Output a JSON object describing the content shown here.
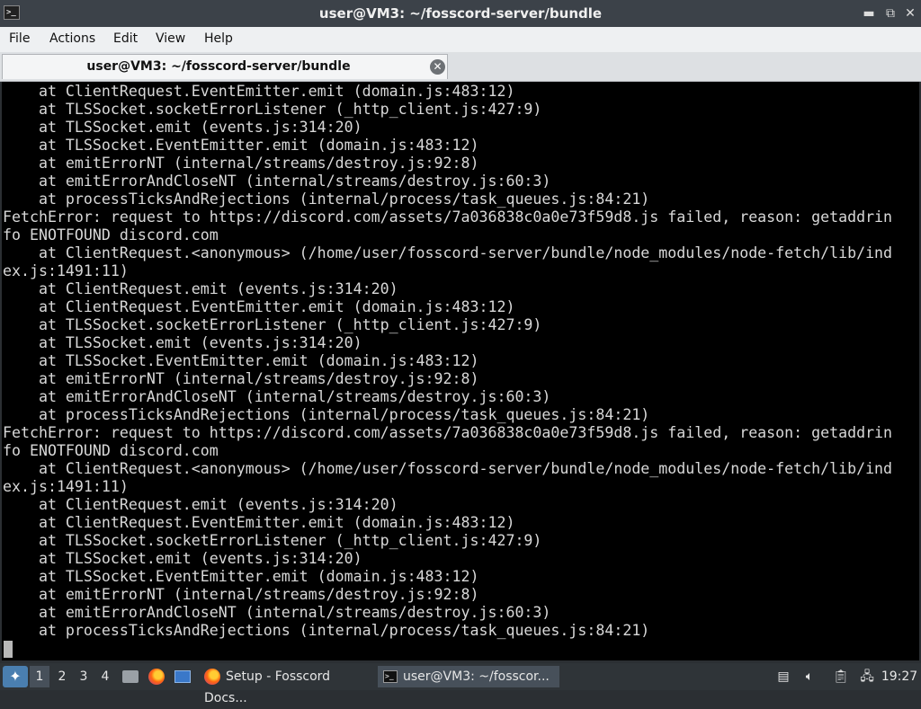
{
  "window": {
    "title": "user@VM3: ~/fosscord-server/bundle",
    "app_icon": "terminal-icon",
    "controls": [
      "minimize-icon",
      "maximize-icon",
      "close-icon"
    ],
    "control_glyphs": {
      "minimize": "▬",
      "maximize": "⧉",
      "close": "✕"
    }
  },
  "menubar": {
    "items": [
      "File",
      "Actions",
      "Edit",
      "View",
      "Help"
    ]
  },
  "tab": {
    "label": "user@VM3: ~/fosscord-server/bundle",
    "close_glyph": "✕"
  },
  "terminal": {
    "lines": [
      "    at ClientRequest.EventEmitter.emit (domain.js:483:12)",
      "    at TLSSocket.socketErrorListener (_http_client.js:427:9)",
      "    at TLSSocket.emit (events.js:314:20)",
      "    at TLSSocket.EventEmitter.emit (domain.js:483:12)",
      "    at emitErrorNT (internal/streams/destroy.js:92:8)",
      "    at emitErrorAndCloseNT (internal/streams/destroy.js:60:3)",
      "    at processTicksAndRejections (internal/process/task_queues.js:84:21)",
      "FetchError: request to https://discord.com/assets/7a036838c0a0e73f59d8.js failed, reason: getaddrin",
      "fo ENOTFOUND discord.com",
      "    at ClientRequest.<anonymous> (/home/user/fosscord-server/bundle/node_modules/node-fetch/lib/ind",
      "ex.js:1491:11)",
      "    at ClientRequest.emit (events.js:314:20)",
      "    at ClientRequest.EventEmitter.emit (domain.js:483:12)",
      "    at TLSSocket.socketErrorListener (_http_client.js:427:9)",
      "    at TLSSocket.emit (events.js:314:20)",
      "    at TLSSocket.EventEmitter.emit (domain.js:483:12)",
      "    at emitErrorNT (internal/streams/destroy.js:92:8)",
      "    at emitErrorAndCloseNT (internal/streams/destroy.js:60:3)",
      "    at processTicksAndRejections (internal/process/task_queues.js:84:21)",
      "FetchError: request to https://discord.com/assets/7a036838c0a0e73f59d8.js failed, reason: getaddrin",
      "fo ENOTFOUND discord.com",
      "    at ClientRequest.<anonymous> (/home/user/fosscord-server/bundle/node_modules/node-fetch/lib/ind",
      "ex.js:1491:11)",
      "    at ClientRequest.emit (events.js:314:20)",
      "    at ClientRequest.EventEmitter.emit (domain.js:483:12)",
      "    at TLSSocket.socketErrorListener (_http_client.js:427:9)",
      "    at TLSSocket.emit (events.js:314:20)",
      "    at TLSSocket.EventEmitter.emit (domain.js:483:12)",
      "    at emitErrorNT (internal/streams/destroy.js:92:8)",
      "    at emitErrorAndCloseNT (internal/streams/destroy.js:60:3)",
      "    at processTicksAndRejections (internal/process/task_queues.js:84:21)"
    ]
  },
  "taskbar": {
    "start_icon": "start-menu-icon",
    "workspaces": [
      "1",
      "2",
      "3",
      "4"
    ],
    "active_workspace": "1",
    "launchers": [
      "file-manager-icon",
      "firefox-icon",
      "show-desktop-icon"
    ],
    "tasks": [
      {
        "label": "Setup - Fosscord Docs...",
        "icon": "firefox-icon"
      },
      {
        "label": "user@VM3: ~/fosscor...",
        "icon": "terminal-icon",
        "active": true
      }
    ],
    "tray": [
      "removable-drive-icon",
      "volume-icon",
      "clipboard-icon",
      "network-icon"
    ],
    "clock": "19:27"
  }
}
